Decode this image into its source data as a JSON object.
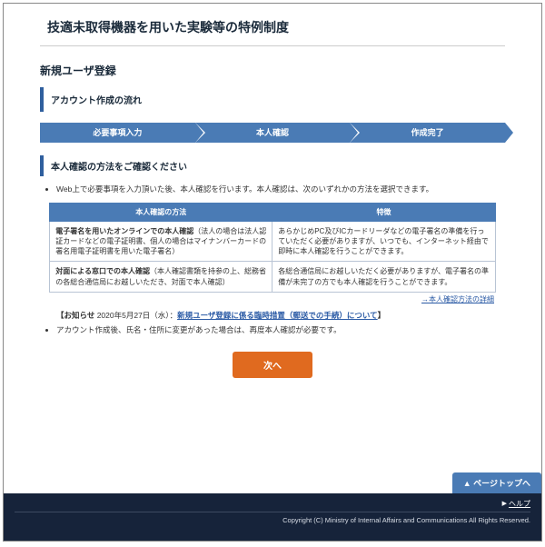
{
  "header": {
    "title": "技適未取得機器を用いた実験等の特例制度"
  },
  "page": {
    "title": "新規ユーザ登録"
  },
  "flow": {
    "label": "アカウント作成の流れ",
    "steps": [
      "必要事項入力",
      "本人確認",
      "作成完了"
    ]
  },
  "section": {
    "label": "本人確認の方法をご確認ください"
  },
  "intro_bullet": "Web上で必要事項を入力頂いた後、本人確認を行います。本人確認は、次のいずれかの方法を選択できます。",
  "table": {
    "headers": [
      "本人確認の方法",
      "特徴"
    ],
    "rows": [
      {
        "method_label": "電子署名を用いたオンラインでの本人確認",
        "method_note": "（法人の場合は法人認証カードなどの電子証明書、個人の場合はマイナンバーカードの署名用電子証明書を用いた電子署名）",
        "feature": "あらかじめPC及びICカードリーダなどの電子署名の準備を行っていただく必要がありますが、いつでも、インターネット経由で即時に本人確認を行うことができます。"
      },
      {
        "method_label": "対面による窓口での本人確認",
        "method_note": "（本人確認書類を持参の上、総務省の各総合通信局にお越しいただき、対面で本人確認）",
        "feature": "各総合通信局にお越しいただく必要がありますが、電子署名の準備が未完了の方でも本人確認を行うことができます。"
      }
    ]
  },
  "detail_link": "→本人確認方法の詳細",
  "notice": {
    "prefix": "【お知らせ",
    "date": " 2020年5月27日（水）",
    "colon": "：",
    "link": "新規ユーザ登録に係る臨時措置（郵送での手続）について",
    "suffix": "】"
  },
  "post_bullet": "アカウント作成後、氏名・住所に変更があった場合は、再度本人確認が必要です。",
  "buttons": {
    "next": "次へ"
  },
  "footer": {
    "pagetop": "▲ ページトップへ",
    "help": "ヘルプ",
    "copyright": "Copyright (C) Ministry of Internal Affairs and Communications All Rights Reserved."
  }
}
